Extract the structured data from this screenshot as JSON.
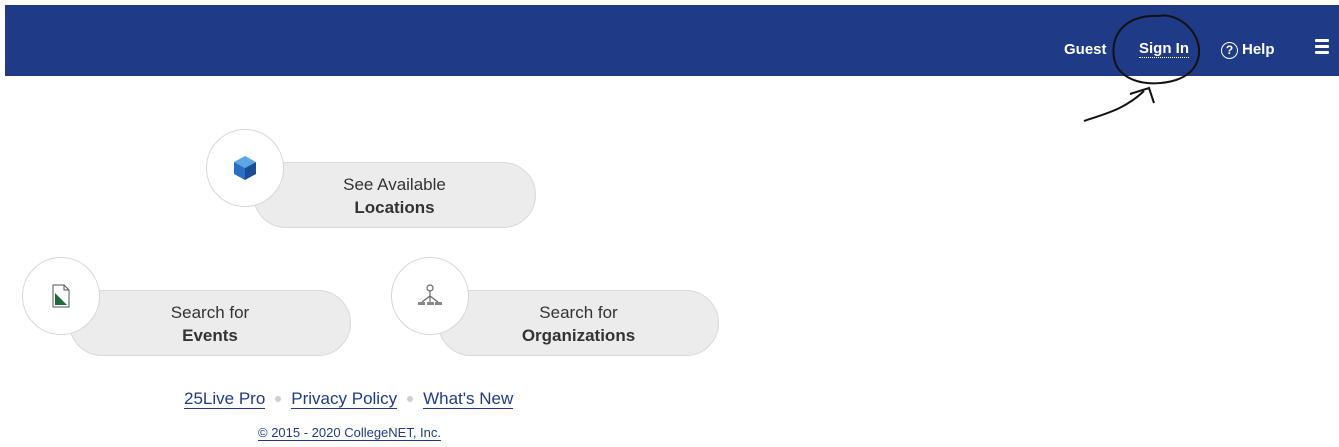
{
  "header": {
    "user_label": "Guest",
    "sign_in_label": "Sign In",
    "help_icon_glyph": "?",
    "help_label": "Help",
    "menu_icon": "hamburger-menu-icon",
    "background_color": "#1f3b87"
  },
  "cards": [
    {
      "icon": "cube-icon",
      "line1": "See Available",
      "line2": "Locations"
    },
    {
      "icon": "document-icon",
      "line1": "Search for",
      "line2": "Events"
    },
    {
      "icon": "org-chart-icon",
      "line1": "Search for",
      "line2": "Organizations"
    }
  ],
  "footer": {
    "links": [
      "25Live Pro",
      "Privacy Policy",
      "What's New"
    ],
    "copyright": "© 2015 - 2020 CollegeNET, Inc."
  }
}
